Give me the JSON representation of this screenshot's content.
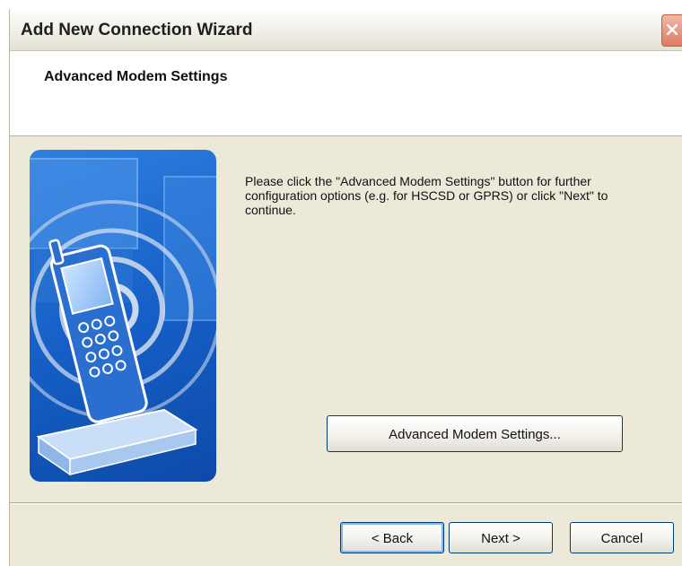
{
  "window": {
    "title": "Add New Connection Wizard",
    "close_icon": "close-icon"
  },
  "header": {
    "title": "Advanced Modem Settings"
  },
  "main": {
    "illustration": "mobile-phone-signal-illustration",
    "instructions": "Please click the \"Advanced Modem Settings\" button for further configuration options (e.g. for HSCSD or GPRS) or click \"Next\" to continue.",
    "advanced_button_label": "Advanced Modem Settings..."
  },
  "footer": {
    "back_label": "< Back",
    "next_label": "Next >",
    "cancel_label": "Cancel"
  },
  "colors": {
    "dialog_bg": "#ece9d8",
    "illustration_blue": "#1660c8",
    "button_border": "#003c74"
  }
}
